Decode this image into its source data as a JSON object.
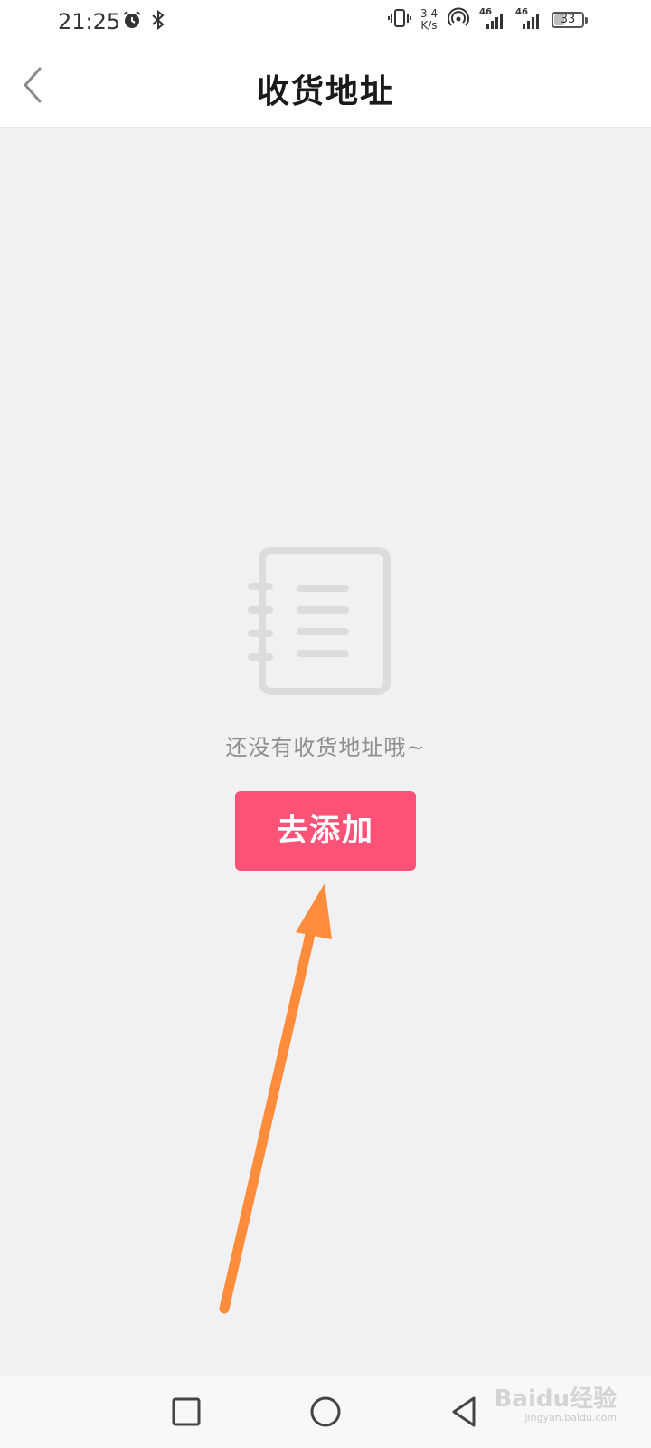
{
  "status_bar": {
    "time": "21:25",
    "net_speed_value": "3.4",
    "net_speed_unit": "K/s",
    "sim1_label": "46",
    "sim2_label": "46",
    "battery": "33",
    "battery_level": 0.33
  },
  "header": {
    "title": "收货地址",
    "back_icon": "chevron-left-icon"
  },
  "empty_state": {
    "icon": "notebook-icon",
    "message": "还没有收货地址哦~",
    "action_label": "去添加"
  },
  "system_nav": {
    "recent": "square-icon",
    "home": "circle-icon",
    "back": "triangle-back-icon"
  },
  "watermark": {
    "brand": "Baidu经验",
    "url": "jingyan.baidu.com"
  },
  "colors": {
    "accent": "#fc5277",
    "annotation_arrow": "#ff8c3a",
    "background": "#f1f1f3"
  }
}
